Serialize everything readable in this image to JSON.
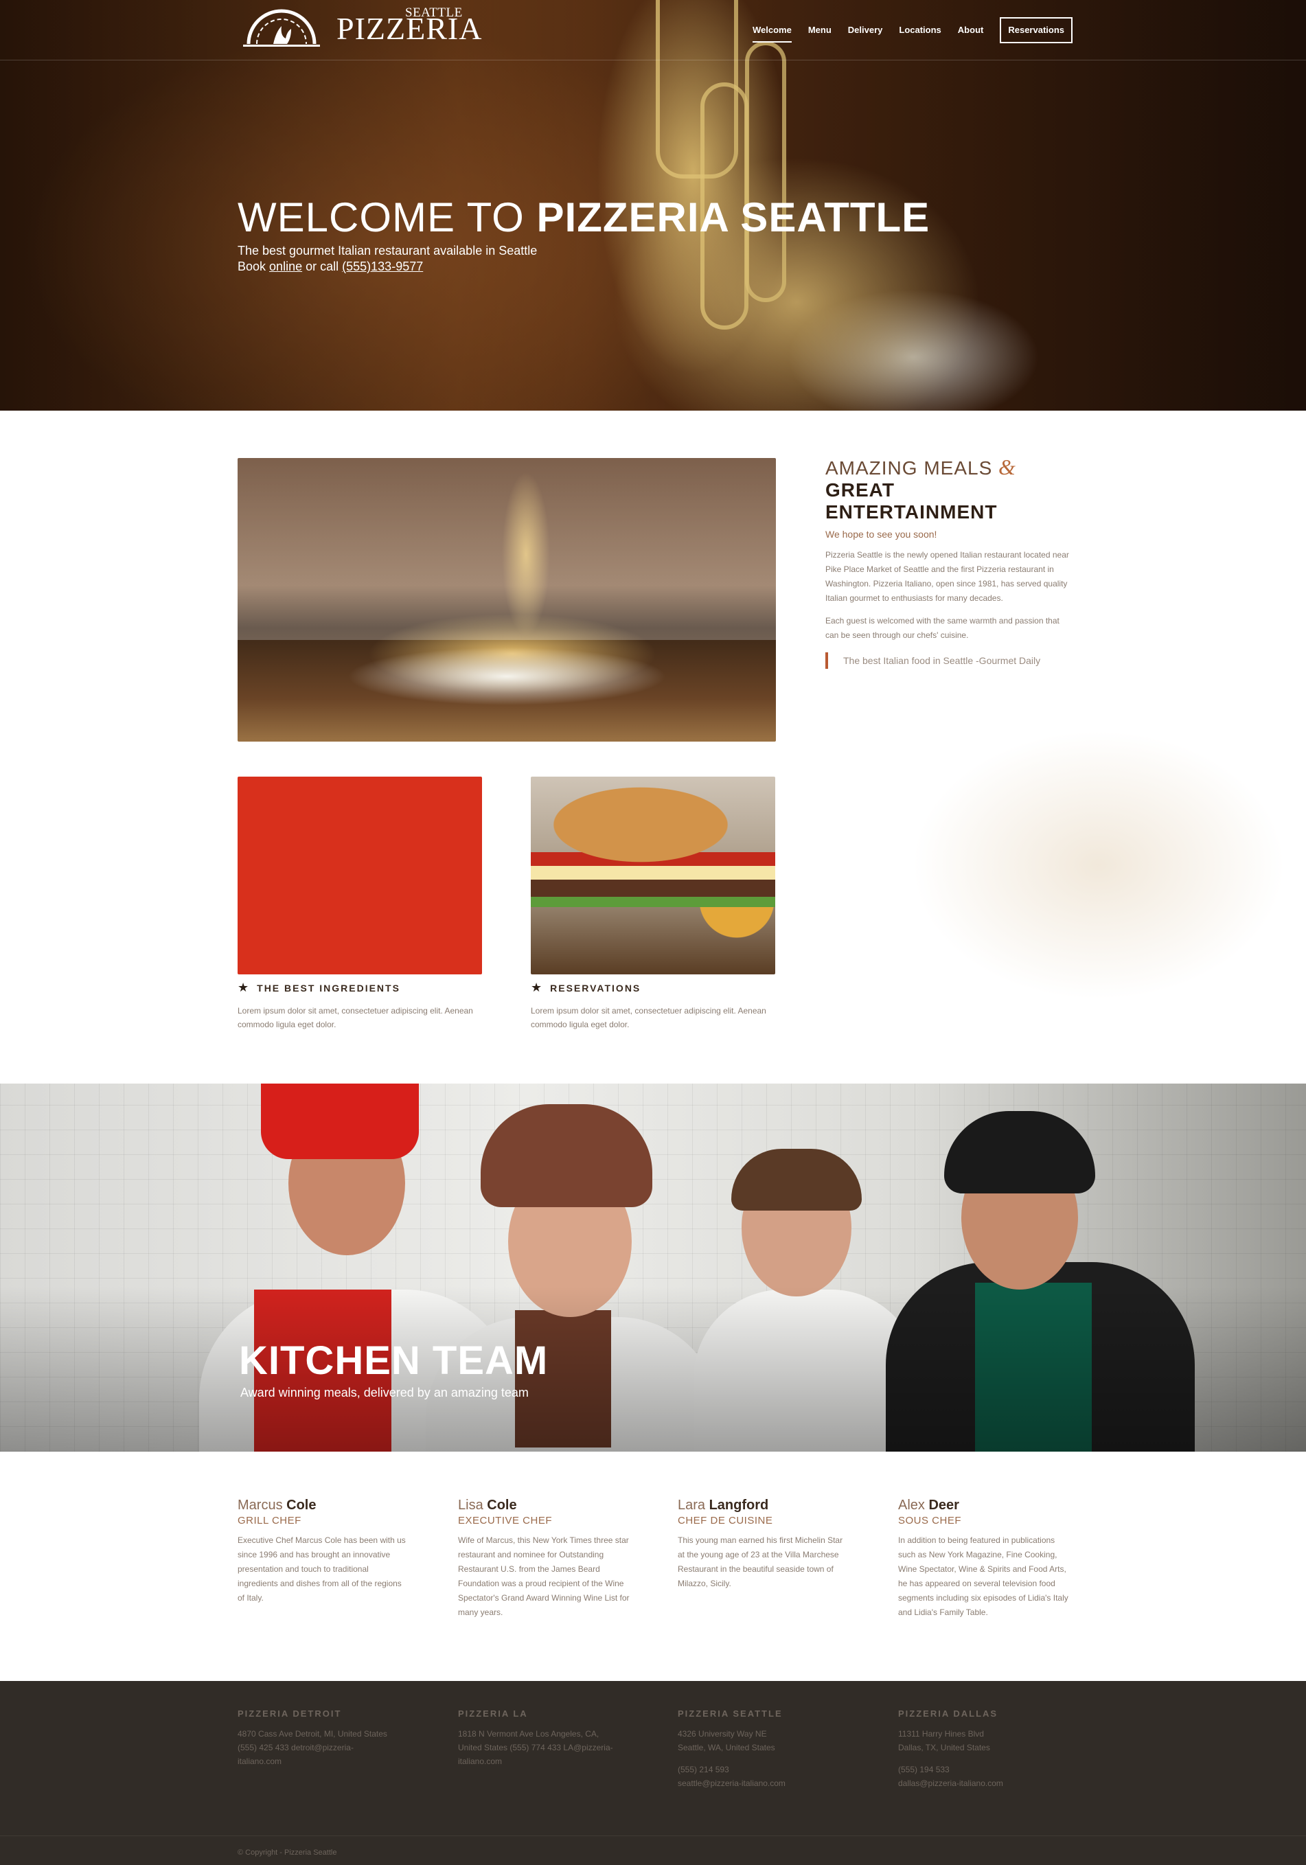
{
  "brand": {
    "city": "SEATTLE",
    "name": "PIZZERIA"
  },
  "nav": {
    "items": [
      "Welcome",
      "Menu",
      "Delivery",
      "Locations",
      "About"
    ],
    "cta": "Reservations",
    "active": "Welcome"
  },
  "hero": {
    "title_light": "WELCOME TO",
    "title_bold": "PIZZERIA SEATTLE",
    "subtitle": "The best gourmet Italian restaurant available in Seattle",
    "book_prefix": "Book",
    "book_link": "online",
    "book_mid": "or call",
    "phone": "(555)133-9577"
  },
  "about": {
    "title_light": "AMAZING MEALS",
    "amp": "&",
    "title_bold": "GREAT ENTERTAINMENT",
    "lead": "We hope to see you soon!",
    "p1": "Pizzeria Seattle is the newly opened Italian restaurant located near Pike Place Market of Seattle and the first Pizzeria restaurant in Washington. Pizzeria Italiano, open since 1981, has served quality Italian gourmet to enthusiasts for many decades.",
    "p2": "Each guest is welcomed with the same warmth and passion that can be seen through our chefs' cuisine.",
    "quote": "The best Italian food in Seattle -Gourmet Daily"
  },
  "features": [
    {
      "title": "THE BEST INGREDIENTS",
      "text": "Lorem ipsum dolor sit amet, consectetuer adipiscing elit. Aenean commodo ligula eget dolor.",
      "icon": "star-icon"
    },
    {
      "title": "RESERVATIONS",
      "text": "Lorem ipsum dolor sit amet, consectetuer adipiscing elit. Aenean commodo ligula eget dolor.",
      "icon": "star-icon"
    }
  ],
  "team": {
    "title_light": "KITCHEN",
    "title_bold": "TEAM",
    "subtitle": "Award winning meals, delivered by an amazing team"
  },
  "staff": [
    {
      "first": "Marcus",
      "last": "Cole",
      "role": "GRILL CHEF",
      "bio": "Executive Chef Marcus Cole has been with us since 1996 and has brought an innovative presentation and touch to traditional ingredients and dishes from all of the regions of Italy."
    },
    {
      "first": "Lisa",
      "last": "Cole",
      "role": "EXECUTIVE CHEF",
      "bio": "Wife of Marcus, this New York Times three star restaurant and nominee for Outstanding Restaurant U.S. from the James Beard Foundation was a proud recipient of the Wine Spectator's Grand Award Winning Wine List for many years."
    },
    {
      "first": "Lara",
      "last": "Langford",
      "role": "CHEF DE CUISINE",
      "bio": "This young man earned his first Michelin Star at the young age of 23 at the Villa Marchese Restaurant in the beautiful seaside town of Milazzo, Sicily."
    },
    {
      "first": "Alex",
      "last": "Deer",
      "role": "SOUS CHEF",
      "bio": "In addition to being featured in publications such as New York Magazine, Fine Cooking, Wine Spectator, Wine & Spirits and Food Arts, he has appeared on several television food segments including six episodes of Lidia's Italy and Lidia's Family Table."
    }
  ],
  "locations": [
    {
      "name": "PIZZERIA DETROIT",
      "lines": [
        "4870 Cass Ave Detroit, MI, United States",
        "(555) 425 433 detroit@pizzeria-",
        "italiano.com"
      ]
    },
    {
      "name": "PIZZERIA LA",
      "lines": [
        "1818 N Vermont Ave Los Angeles, CA,",
        "United States (555) 774 433 LA@pizzeria-",
        "italiano.com"
      ]
    },
    {
      "name": "PIZZERIA SEATTLE",
      "lines": [
        "4326 University Way NE",
        "Seattle, WA, United States",
        "",
        "(555) 214 593",
        "seattle@pizzeria-italiano.com"
      ]
    },
    {
      "name": "PIZZERIA DALLAS",
      "lines": [
        "11311 Harry Hines Blvd",
        "Dallas, TX, United States",
        "",
        "(555) 194 533",
        "dallas@pizzeria-italiano.com"
      ]
    }
  ],
  "copyright": "© Copyright - Pizzeria Seattle",
  "colors": {
    "accent": "#b95a32",
    "footer": "#312c27",
    "heading": "#2e1f15"
  }
}
